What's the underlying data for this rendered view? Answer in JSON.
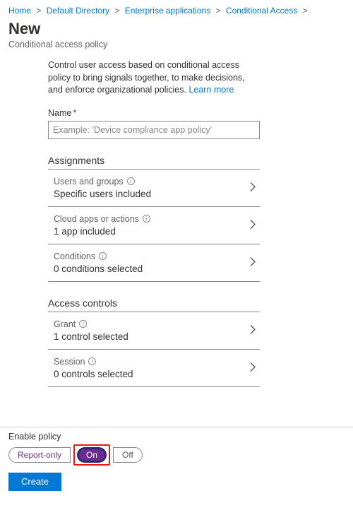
{
  "breadcrumb": {
    "items": [
      {
        "label": "Home"
      },
      {
        "label": "Default Directory"
      },
      {
        "label": "Enterprise applications"
      },
      {
        "label": "Conditional Access"
      }
    ]
  },
  "header": {
    "title": "New",
    "subtitle": "Conditional access policy"
  },
  "description": {
    "text": "Control user access based on conditional access policy to bring signals together, to make decisions, and enforce organizational policies. ",
    "learn_more": "Learn more"
  },
  "name_field": {
    "label": "Name",
    "placeholder": "Example: 'Device compliance app policy'",
    "value": ""
  },
  "assignments": {
    "heading": "Assignments",
    "rows": [
      {
        "title": "Users and groups",
        "value": "Specific users included"
      },
      {
        "title": "Cloud apps or actions",
        "value": "1 app included"
      },
      {
        "title": "Conditions",
        "value": "0 conditions selected"
      }
    ]
  },
  "access_controls": {
    "heading": "Access controls",
    "rows": [
      {
        "title": "Grant",
        "value": "1 control selected"
      },
      {
        "title": "Session",
        "value": "0 controls selected"
      }
    ]
  },
  "enable_policy": {
    "label": "Enable policy",
    "options": {
      "report_only": "Report-only",
      "on": "On",
      "off": "Off"
    },
    "selected": "On"
  },
  "create_button": "Create"
}
